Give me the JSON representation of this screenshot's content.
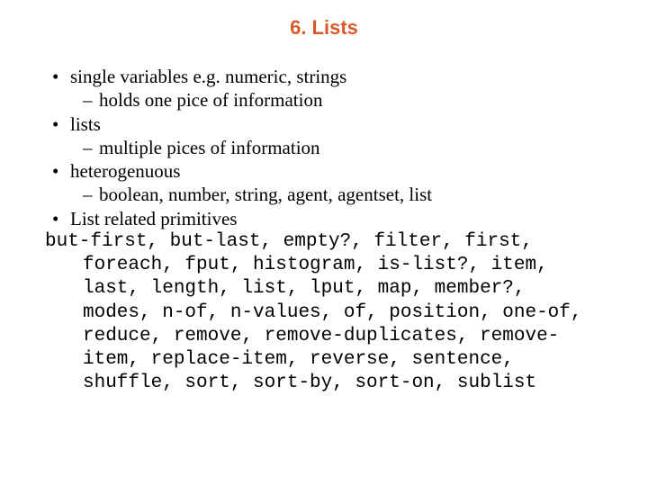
{
  "title": "6. Lists",
  "bullets": {
    "l0": "single variables e.g. numeric, strings",
    "l0s": "holds one pice of information",
    "l1": "lists",
    "l1s": "multiple pices of information",
    "l2": "heterogenuous",
    "l2s": "boolean, number, string, agent, agentset, list",
    "l3": "List related primitives"
  },
  "code": "but-first, but-last, empty?, filter, first, foreach, fput, histogram, is-list?, item, last, length, list, lput, map, member?, modes, n-of, n-values, of, position, one-of, reduce, remove, remove-duplicates, remove-item, replace-item, reverse, sentence, shuffle, sort, sort-by, sort-on, sublist"
}
